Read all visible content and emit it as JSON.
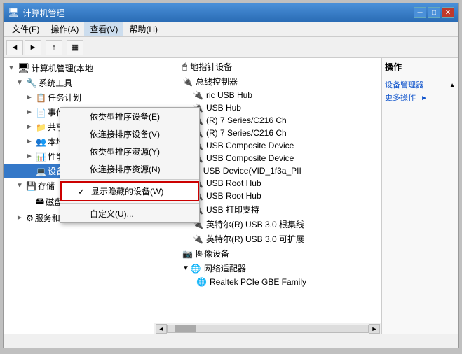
{
  "window": {
    "title": "计算机管理",
    "title_icon": "🖥",
    "min_btn": "─",
    "max_btn": "□",
    "close_btn": "✕"
  },
  "menu": {
    "file": "文件(F)",
    "action": "操作(A)",
    "view": "查看(V)",
    "help": "帮助(H)"
  },
  "view_dropdown": {
    "items": [
      {
        "id": "sort-by-type",
        "label": "依类型排序设备(E)",
        "check": ""
      },
      {
        "id": "sort-by-conn",
        "label": "依连接排序设备(V)",
        "check": ""
      },
      {
        "id": "sort-res-by-type",
        "label": "依类型排序资源(Y)",
        "check": ""
      },
      {
        "id": "sort-res-by-conn",
        "label": "依连接排序资源(N)",
        "check": ""
      },
      {
        "id": "show-hidden",
        "label": "显示隐藏的设备(W)",
        "check": "✓",
        "highlighted": true
      },
      {
        "id": "customize",
        "label": "自定义(U)...",
        "check": ""
      }
    ]
  },
  "toolbar": {
    "back": "◄",
    "forward": "►",
    "up": "↑",
    "view": "▦"
  },
  "left_tree": {
    "items": [
      {
        "level": 0,
        "label": "计算机管理(本地",
        "icon": "computer",
        "toggle": "▼",
        "selected": false
      },
      {
        "level": 1,
        "label": "系统工具",
        "icon": "tools",
        "toggle": "▼",
        "selected": false
      },
      {
        "level": 2,
        "label": "任务计划",
        "icon": "tasks",
        "toggle": "►",
        "selected": false
      },
      {
        "level": 2,
        "label": "事件查看",
        "icon": "events",
        "toggle": "►",
        "selected": false
      },
      {
        "level": 2,
        "label": "共享文件夹",
        "icon": "folder",
        "toggle": "►",
        "selected": false
      },
      {
        "level": 2,
        "label": "本地用户",
        "icon": "users",
        "toggle": "►",
        "selected": false
      },
      {
        "level": 2,
        "label": "性能",
        "icon": "perf",
        "toggle": "►",
        "selected": false
      },
      {
        "level": 2,
        "label": "设备管理器",
        "icon": "devices",
        "toggle": "",
        "selected": true
      },
      {
        "level": 1,
        "label": "存储",
        "icon": "storage",
        "toggle": "▼",
        "selected": false
      },
      {
        "level": 2,
        "label": "磁盘管理",
        "icon": "disk",
        "toggle": "",
        "selected": false
      },
      {
        "level": 1,
        "label": "服务和应用程序",
        "icon": "services",
        "toggle": "►",
        "selected": false
      }
    ]
  },
  "device_list": {
    "items": [
      {
        "label": "地指针设备",
        "icon": "usb",
        "indent": 40
      },
      {
        "label": "总线控制器",
        "icon": "usb",
        "indent": 40
      },
      {
        "label": "ric USB Hub",
        "icon": "usb",
        "indent": 60
      },
      {
        "label": "USB Hub",
        "icon": "usb",
        "indent": 60
      },
      {
        "label": "(R) 7 Series/C216 Ch",
        "icon": "usb",
        "indent": 60
      },
      {
        "label": "(R) 7 Series/C216 Ch",
        "icon": "usb",
        "indent": 60
      },
      {
        "label": "USB Composite Device",
        "icon": "usb",
        "indent": 60
      },
      {
        "label": "USB Composite Device",
        "icon": "usb",
        "indent": 60
      },
      {
        "label": "USB Device(VID_1f3a_PII",
        "icon": "usb_warn",
        "indent": 60
      },
      {
        "label": "USB Root Hub",
        "icon": "usb",
        "indent": 60
      },
      {
        "label": "USB Root Hub",
        "icon": "usb",
        "indent": 60
      },
      {
        "label": "USB 打印支持",
        "icon": "usb",
        "indent": 60
      },
      {
        "label": "英特尔(R) USB 3.0 根集线",
        "icon": "usb",
        "indent": 60
      },
      {
        "label": "英特尔(R) USB 3.0 可扩展",
        "icon": "usb",
        "indent": 60
      },
      {
        "label": "图像设备",
        "icon": "image",
        "indent": 40
      },
      {
        "label": "网络适配器",
        "icon": "net",
        "indent": 40,
        "expanded": true
      },
      {
        "label": "Realtek PCIe GBE Family",
        "icon": "net",
        "indent": 60
      }
    ]
  },
  "actions": {
    "title": "操作",
    "device_manager": "设备管理器",
    "more_actions": "更多操作",
    "arrow": "►"
  }
}
